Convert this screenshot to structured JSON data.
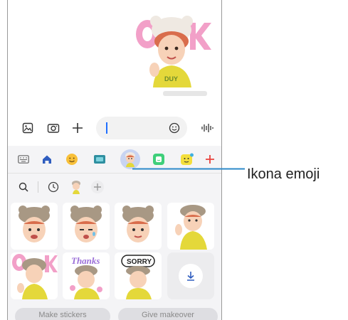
{
  "input_bar": {
    "gallery_icon": "image-icon",
    "camera_icon": "camera-icon",
    "add_icon": "plus-icon",
    "message_value": "",
    "emoji_icon": "smiley-icon",
    "voice_icon": "voice-wave-icon"
  },
  "panel_tabs": [
    {
      "icon": "keyboard-icon"
    },
    {
      "icon": "home-icon"
    },
    {
      "icon": "emoji-face-icon"
    },
    {
      "icon": "gif-icon"
    },
    {
      "icon": "ar-emoji-avatar-icon",
      "selected": true
    },
    {
      "icon": "bitmoji-icon"
    },
    {
      "icon": "sticker-icon"
    },
    {
      "icon": "add-icon"
    }
  ],
  "sub_tabs": [
    {
      "icon": "search-icon"
    },
    {
      "icon": "recent-clock-icon"
    },
    {
      "icon": "avatar-stickers-icon"
    },
    {
      "icon": "add-icon"
    }
  ],
  "stickers": {
    "sticker_thanks_text": "Thanks",
    "sticker_sorry_text": "SORRY",
    "sticker_ok_text": "OK",
    "shirt_text": "DUY"
  },
  "download_icon": "download-icon",
  "buttons": {
    "make_stickers": "Make stickers",
    "give_makeover": "Give makeover"
  },
  "callout": {
    "label": "Ikona emoji"
  },
  "colors": {
    "accent_red": "#e8413c",
    "callout_blue": "#2c8ac9",
    "selected_tab": "#c8d4f2"
  }
}
